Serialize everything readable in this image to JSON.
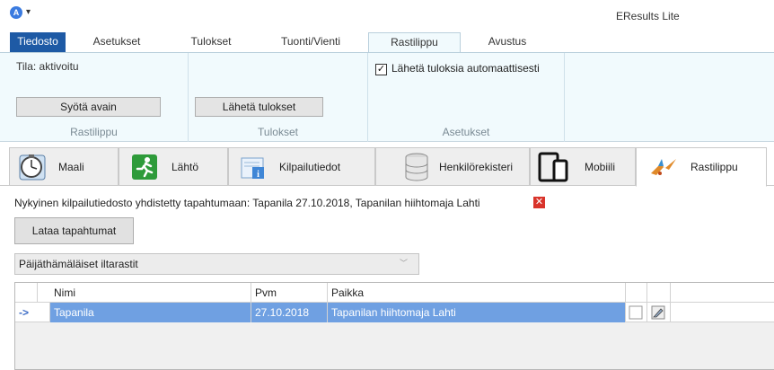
{
  "window": {
    "title": "EResults Lite",
    "app_icon_letter": "A"
  },
  "ribbon_tabs": [
    {
      "label": "Tiedosto"
    },
    {
      "label": "Asetukset"
    },
    {
      "label": "Tulokset"
    },
    {
      "label": "Tuonti/Vienti"
    },
    {
      "label": "Rastilippu"
    },
    {
      "label": "Avustus"
    }
  ],
  "ribbon": {
    "groups": [
      {
        "label": "Rastilippu",
        "status": "Tila: aktivoitu",
        "button": "Syötä avain"
      },
      {
        "label": "Tulokset",
        "button": "Lähetä tulokset"
      },
      {
        "label": "Asetukset",
        "checkbox_label": "Lähetä tuloksia automaattisesti",
        "checkbox_checked": true
      }
    ]
  },
  "module_tabs": [
    {
      "label": "Maali",
      "icon": "stopwatch-icon"
    },
    {
      "label": "Lähtö",
      "icon": "runner-icon"
    },
    {
      "label": "Kilpailutiedot",
      "icon": "info-document-icon"
    },
    {
      "label": "Henkilörekisteri",
      "icon": "database-icon"
    },
    {
      "label": "Mobiili",
      "icon": "mobile-devices-icon"
    },
    {
      "label": "Rastilippu",
      "icon": "bird-icon"
    }
  ],
  "content": {
    "info_text": "Nykyinen kilpailutiedosto yhdistetty tapahtumaan: Tapanila 27.10.2018, Tapanilan hiihtomaja Lahti",
    "load_button": "Lataa tapahtumat",
    "selected_series": "Päijäthämäläiset iltarastit"
  },
  "grid": {
    "columns": [
      "Nimi",
      "Pvm",
      "Paikka"
    ],
    "rows": [
      {
        "indicator": "->",
        "name": "Tapanila",
        "date": "27.10.2018",
        "place": "Tapanilan hiihtomaja Lahti"
      }
    ]
  },
  "colors": {
    "accent": "#1e5aa5",
    "ribbon_bg": "#f1fafd",
    "selection": "#6fa0e2",
    "delete": "#d9342b"
  }
}
